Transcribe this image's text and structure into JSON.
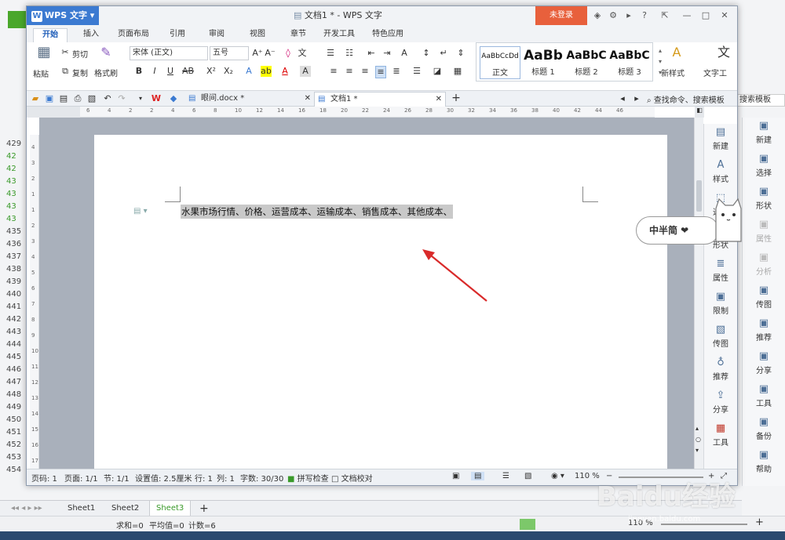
{
  "app": {
    "menu_label": "WPS 文字",
    "window_title": "文档1 * - WPS 文字",
    "login_label": "未登录"
  },
  "menu_tabs": [
    "开始",
    "插入",
    "页面布局",
    "引用",
    "审阅",
    "视图",
    "章节",
    "开发工具",
    "特色应用"
  ],
  "ribbon": {
    "paste": "粘贴",
    "cut": "剪切",
    "copy": "复制",
    "format_painter": "格式刷",
    "font_name": "宋体 (正文)",
    "font_size": "五号",
    "styles": [
      {
        "preview": "AaBbCcDd",
        "name": "正文"
      },
      {
        "preview": "AaBb",
        "name": "标题 1"
      },
      {
        "preview": "AaBbC",
        "name": "标题 2"
      },
      {
        "preview": "AaBbC",
        "name": "标题 3"
      }
    ],
    "new_style": "新样式",
    "text_tools": "文字工"
  },
  "doc_tabs": [
    {
      "label": "眼间.docx *"
    },
    {
      "label": "文档1 *"
    }
  ],
  "search_label": "查找命令、搜索模板",
  "document": {
    "text": "水果市场行情、价格、运营成本、运输成本、销售成本、其他成本、"
  },
  "ruler_marks": [
    "6",
    "4",
    "2",
    "2",
    "4",
    "6",
    "8",
    "10",
    "12",
    "14",
    "16",
    "18",
    "20",
    "22",
    "24",
    "26",
    "28",
    "30",
    "32",
    "34",
    "36",
    "38",
    "40",
    "42",
    "44",
    "46"
  ],
  "vruler_marks": [
    "4",
    "3",
    "2",
    "1",
    "1",
    "2",
    "3",
    "4",
    "5",
    "6",
    "7",
    "8",
    "9",
    "10",
    "11",
    "12",
    "13",
    "14",
    "15",
    "16",
    "17"
  ],
  "right_pane": [
    {
      "icon": "new-icon",
      "label": "新建"
    },
    {
      "icon": "style-icon",
      "label": "样式"
    },
    {
      "icon": "select-icon",
      "label": "选择"
    },
    {
      "icon": "shape-icon",
      "label": "形状"
    },
    {
      "icon": "property-icon",
      "label": "属性"
    },
    {
      "icon": "restrict-icon",
      "label": "限制"
    },
    {
      "icon": "image-icon",
      "label": "传图"
    },
    {
      "icon": "recommend-icon",
      "label": "推荐"
    },
    {
      "icon": "share-icon",
      "label": "分享"
    },
    {
      "icon": "tool-icon",
      "label": "工具"
    }
  ],
  "status": {
    "page_no": "页码: 1",
    "pages": "页面: 1/1",
    "section": "节: 1/1",
    "setting": "设置值: 2.5厘米",
    "row": "行: 1",
    "col": "列: 1",
    "words": "字数: 30/30",
    "spellcheck": "拼写检查",
    "proof": "文档校对",
    "zoom": "110 %"
  },
  "background": {
    "row_numbers": [
      "429",
      "42",
      "42",
      "43",
      "43",
      "43",
      "43",
      "435",
      "436",
      "437",
      "438",
      "439",
      "440",
      "441",
      "442",
      "443",
      "444",
      "445",
      "446",
      "447",
      "448",
      "449",
      "450",
      "451",
      "452",
      "453",
      "454"
    ],
    "side_panel": [
      {
        "label": "新建",
        "dim": false
      },
      {
        "label": "选择",
        "dim": false
      },
      {
        "label": "形状",
        "dim": false
      },
      {
        "label": "属性",
        "dim": true
      },
      {
        "label": "分析",
        "dim": true
      },
      {
        "label": "传图",
        "dim": false
      },
      {
        "label": "推荐",
        "dim": false
      },
      {
        "label": "分享",
        "dim": false
      },
      {
        "label": "工具",
        "dim": false
      },
      {
        "label": "备份",
        "dim": false
      },
      {
        "label": "帮助",
        "dim": false
      }
    ],
    "sheets": [
      "Sheet1",
      "Sheet2",
      "Sheet3"
    ],
    "active_sheet": "Sheet3",
    "status_sum": "求和=0",
    "status_avg": "平均值=0",
    "status_count": "计数=6",
    "zoom": "110 %",
    "search_label": "搜索模板"
  },
  "sticker": {
    "text": "中半简 ❤"
  },
  "watermark": {
    "main": "Baidu经验",
    "sub": "jingyan.baidu.com"
  },
  "colors": {
    "accent": "#3b7ad1",
    "login": "#e8603c",
    "arrow": "#d92a2a",
    "selection": "#c9c9c9"
  }
}
